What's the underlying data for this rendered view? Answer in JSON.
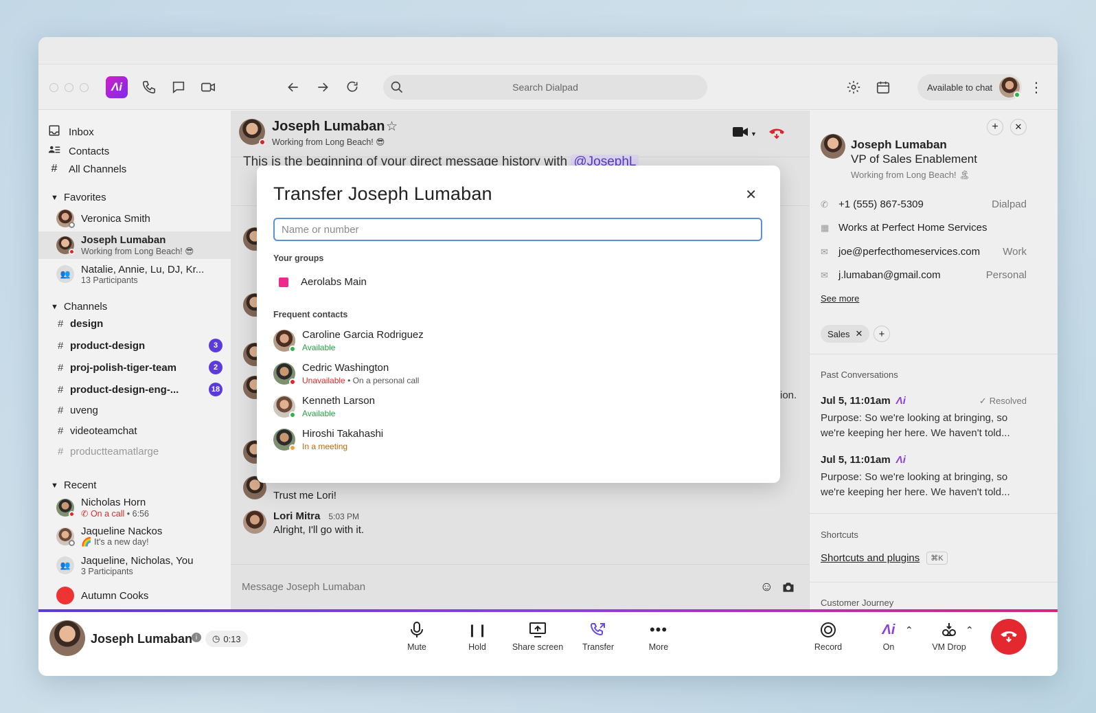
{
  "toolbar": {
    "search_placeholder": "Search Dialpad",
    "availability": "Available to chat",
    "logo_text": "Λi"
  },
  "sidebar": {
    "nav": [
      {
        "label": "Inbox",
        "icon": "inbox-icon"
      },
      {
        "label": "Contacts",
        "icon": "contacts-icon"
      },
      {
        "label": "All Channels",
        "icon": "hash-icon"
      }
    ],
    "favorites_title": "Favorites",
    "favorites": [
      {
        "name": "Veronica Smith",
        "sub": ""
      },
      {
        "name": "Joseph Lumaban",
        "sub": "Working from Long Beach! 😎"
      },
      {
        "name": "Natalie, Annie, Lu, DJ, Kr...",
        "sub": "13 Participants"
      }
    ],
    "channels_title": "Channels",
    "channels": [
      {
        "name": "design",
        "badge": ""
      },
      {
        "name": "product-design",
        "badge": "3"
      },
      {
        "name": "proj-polish-tiger-team",
        "badge": "2"
      },
      {
        "name": "product-design-eng-...",
        "badge": "18"
      },
      {
        "name": "uveng",
        "badge": ""
      },
      {
        "name": "videoteamchat",
        "badge": ""
      },
      {
        "name": "productteamatlarge",
        "badge": ""
      }
    ],
    "recent_title": "Recent",
    "recent": [
      {
        "name": "Nicholas Horn",
        "sub": "On a call",
        "sub2": "• 6:56"
      },
      {
        "name": "Jaqueline Nackos",
        "sub": "🌈 It's a new day!"
      },
      {
        "name": "Jaqueline, Nicholas, You",
        "sub": "3 Participants"
      },
      {
        "name": "Autumn Cooks",
        "sub": ""
      }
    ]
  },
  "chat": {
    "name": "Joseph Lumaban",
    "status": "Working from Long Beach! 😎",
    "history_text": "This is the beginning of your direct message history with",
    "history_mention": "@JosephL",
    "partial_text": "ion.",
    "msg1": "Trust me Lori!",
    "msg2_author": "Lori Mitra",
    "msg2_time": "5:03 PM",
    "msg2_text": "Alright, I'll go with it.",
    "input_placeholder": "Message Joseph Lumaban"
  },
  "modal": {
    "title": "Transfer Joseph Lumaban",
    "placeholder": "Name or number",
    "groups_label": "Your groups",
    "group_name": "Aerolabs Main",
    "frequent_label": "Frequent contacts",
    "contacts": [
      {
        "name": "Caroline Garcia Rodriguez",
        "status": "Available",
        "extra": ""
      },
      {
        "name": "Cedric Washington",
        "status": "Unavailable",
        "extra": "• On a personal call"
      },
      {
        "name": "Kenneth Larson",
        "status": "Available",
        "extra": ""
      },
      {
        "name": "Hiroshi Takahashi",
        "status": "In a meeting",
        "extra": ""
      }
    ],
    "colors": {
      "group": "#ec2c8c",
      "available": "#2a9c45",
      "unavailable": "#d72c2c",
      "meeting": "#b86a10"
    }
  },
  "profile": {
    "name": "Joseph Lumaban",
    "title": "VP of Sales Enablement",
    "status": "Working from Long Beach! 🏝",
    "phone": "+1 (555) 867-5309",
    "phone_tag": "Dialpad",
    "company": "Works at Perfect Home Services",
    "email1": "joe@perfecthomeservices.com",
    "email1_tag": "Work",
    "email2": "j.lumaban@gmail.com",
    "email2_tag": "Personal",
    "see_more": "See more",
    "tag": "Sales",
    "past_title": "Past Conversations",
    "convs": [
      {
        "date": "Jul 5, 11:01am",
        "resolved": "Resolved",
        "text": "Purpose: So we're looking at bringing, so we're keeping her here. We haven't told..."
      },
      {
        "date": "Jul 5, 11:01am",
        "resolved": "",
        "text": "Purpose: So we're looking at bringing, so we're keeping her here. We haven't told..."
      }
    ],
    "shortcuts_title": "Shortcuts",
    "shortcuts_link": "Shortcuts and plugins",
    "shortcuts_key": "⌘K",
    "journey_title": "Customer Journey"
  },
  "callbar": {
    "name": "Joseph Lumaban",
    "timer": "0:13",
    "buttons": [
      "Mute",
      "Hold",
      "Share screen",
      "Transfer",
      "More"
    ],
    "right_buttons": [
      "Record",
      "On",
      "VM Drop"
    ],
    "accent": "#8b3fe0",
    "hangup_color": "#e42830"
  }
}
